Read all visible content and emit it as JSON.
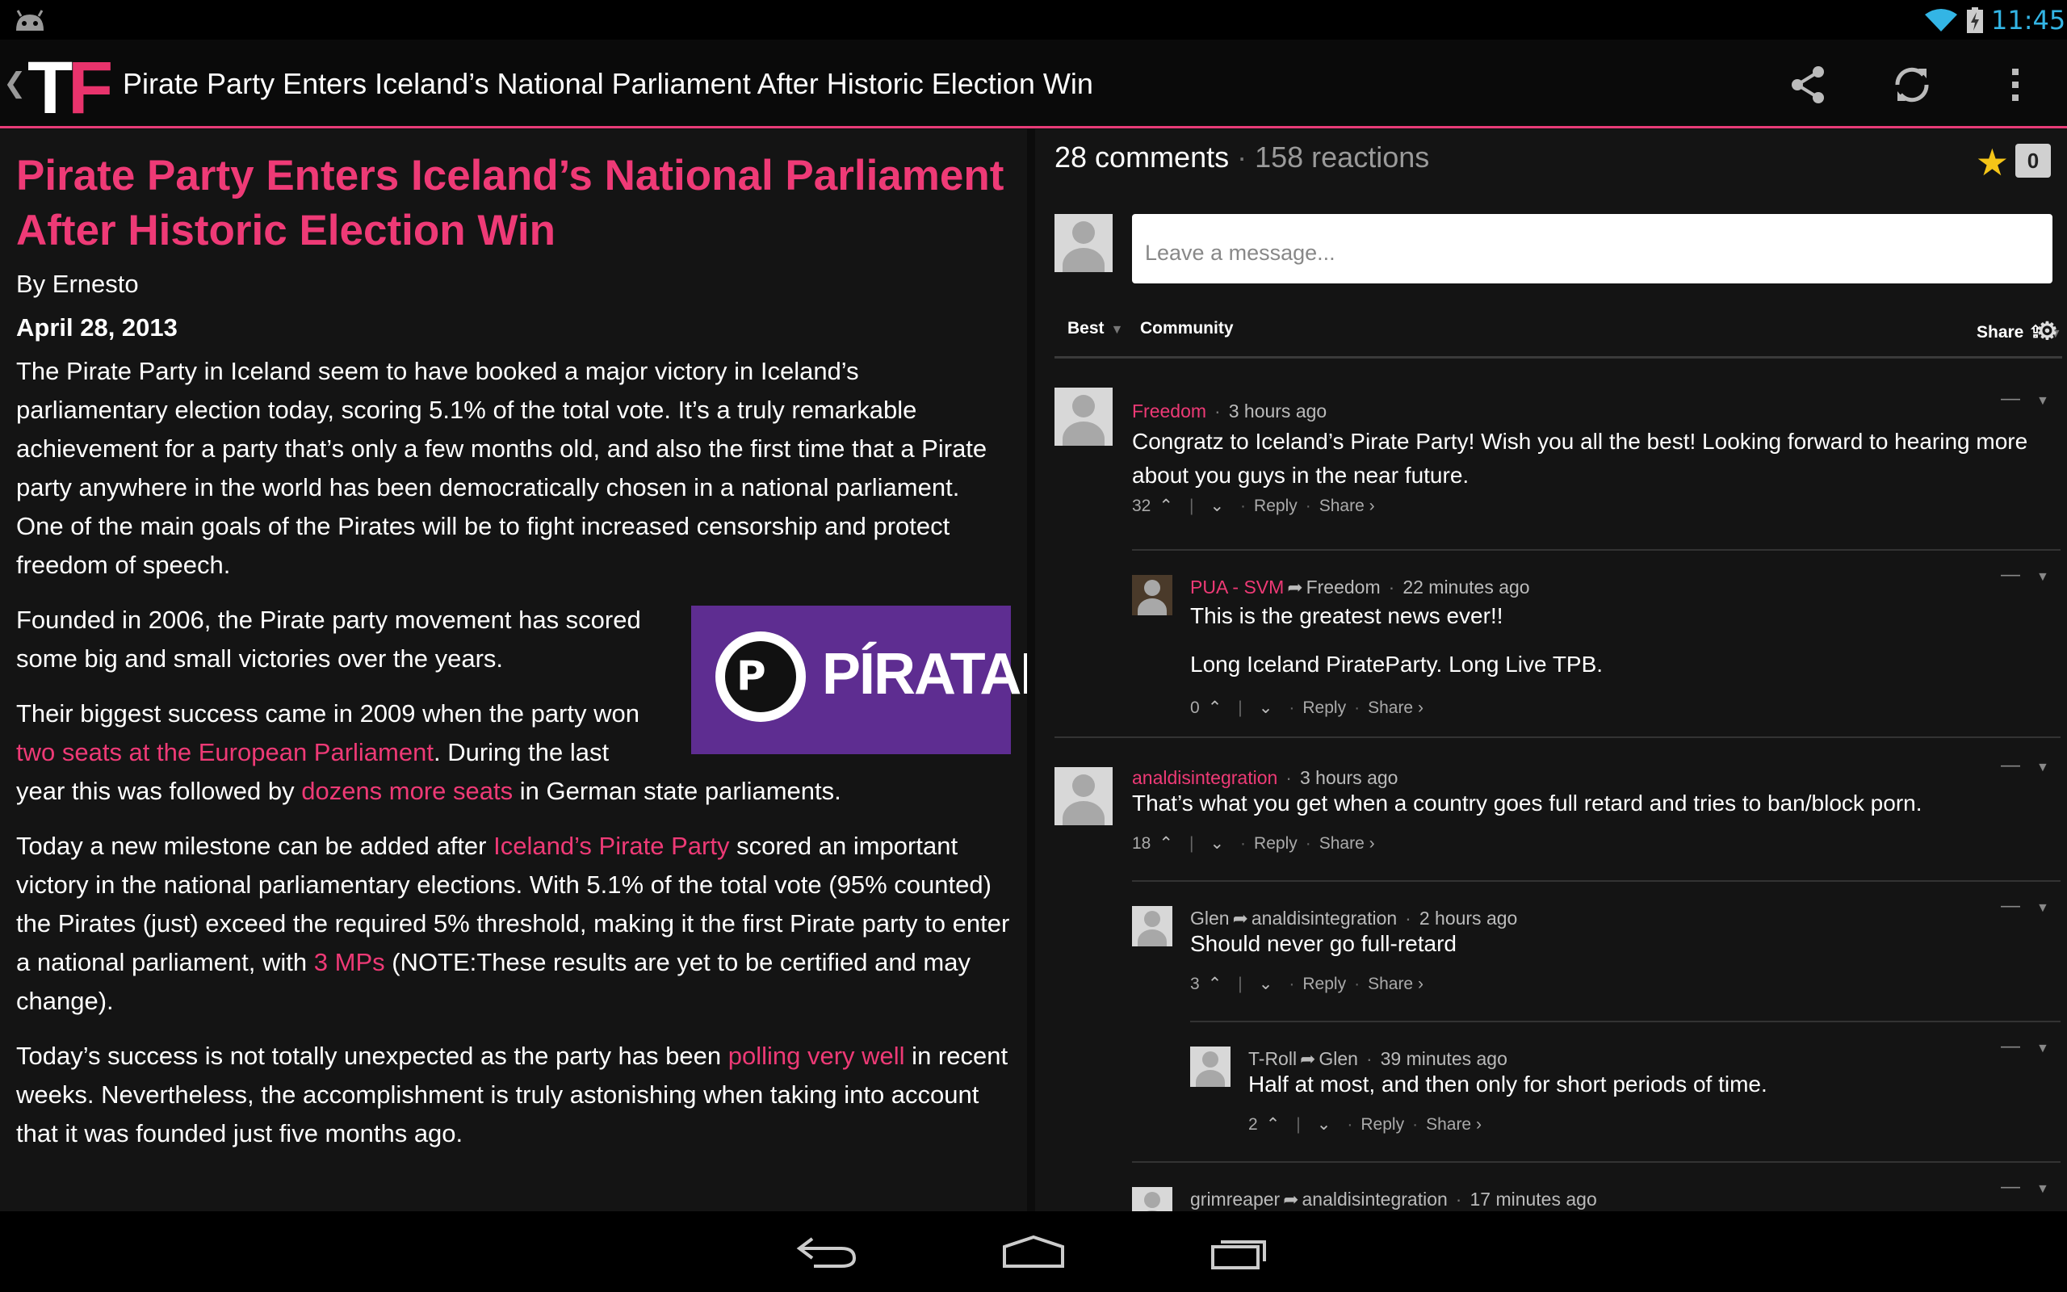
{
  "status_bar": {
    "clock": "11:45"
  },
  "action_bar": {
    "logo_t": "T",
    "logo_f": "F",
    "title": "Pirate Party Enters Iceland’s National Parliament After Historic Election Win"
  },
  "article": {
    "headline": "Pirate Party Enters Iceland’s National Parliament After Historic Election Win",
    "byline": "By Ernesto",
    "date": "April 28, 2013",
    "p1": "The Pirate Party in Iceland seem to have booked a major victory in Iceland’s parliamentary election today, scoring 5.1% of the total vote. It’s a truly remarkable achievement for a party that’s only a few months old, and also the first time that a Pirate party anywhere in the world has been democratically chosen in a national parliament. One of the main goals of the Pirates will be to fight increased censorship and protect freedom of speech.",
    "p2": "Founded in 2006, the Pirate party movement has scored some big and small victories over the years.",
    "p3_a": "Their biggest success came in 2009 when the party won ",
    "p3_link1": "two seats at the European Parliament",
    "p3_b": ". During the last year this was followed by ",
    "p3_link2": "dozens more seats",
    "p3_c": " in German state parliaments.",
    "p4_a": "Today a new milestone can be added after ",
    "p4_link1": "Iceland’s Pirate Party",
    "p4_b": " scored an important victory in the national parliamentary elections. With 5.1% of the total vote (95% counted) the Pirates (just) exceed the required 5% threshold, making it the first Pirate party to enter a national parliament, with ",
    "p4_link2": "3 MPs",
    "p4_c": " (NOTE:These results are yet to be certified and may change).",
    "p5_a": "Today’s success is not totally unexpected as the party has been ",
    "p5_link": "polling very well",
    "p5_b": " in recent weeks. Nevertheless, the accomplishment is truly astonishing when taking into account that it was founded just five months ago.",
    "image_text": "PÍRATAR",
    "image_logo_letter": "P"
  },
  "comments_panel": {
    "count": "28 comments",
    "dot": "·",
    "reactions": "158 reactions",
    "star_count": "0",
    "message_placeholder": "Leave a message...",
    "tabs": {
      "best": "Best",
      "community": "Community",
      "share": "Share"
    },
    "comments": [
      {
        "author": "Freedom",
        "reply_to": "",
        "time": "3 hours ago",
        "text": "Congratz to Iceland’s Pirate Party! Wish you all the best! Looking forward to hearing more about you guys in the near future.",
        "votes": "32",
        "reply": "Reply",
        "share": "Share ›"
      },
      {
        "author": "PUA - SVM",
        "reply_to": "Freedom",
        "time": "22 minutes ago",
        "text": "This is the greatest news ever!!",
        "text2": "Long Iceland PirateParty. Long Live TPB.",
        "votes": "0",
        "reply": "Reply",
        "share": "Share ›"
      },
      {
        "author": "analdisintegration",
        "reply_to": "",
        "time": "3 hours ago",
        "text": "That’s what you get when a country goes full retard and tries to ban/block porn.",
        "votes": "18",
        "reply": "Reply",
        "share": "Share ›"
      },
      {
        "author": "Glen",
        "reply_to": "analdisintegration",
        "time": "2 hours ago",
        "text": "Should never go full-retard",
        "votes": "3",
        "reply": "Reply",
        "share": "Share ›"
      },
      {
        "author": "T-Roll",
        "reply_to": "Glen",
        "time": "39 minutes ago",
        "text": "Half at most, and then only for short periods of time.",
        "votes": "2",
        "reply": "Reply",
        "share": "Share ›"
      },
      {
        "author": "grimreaper",
        "reply_to": "analdisintegration",
        "time": "17 minutes ago",
        "text": "",
        "votes": "",
        "reply": "",
        "share": ""
      }
    ]
  }
}
